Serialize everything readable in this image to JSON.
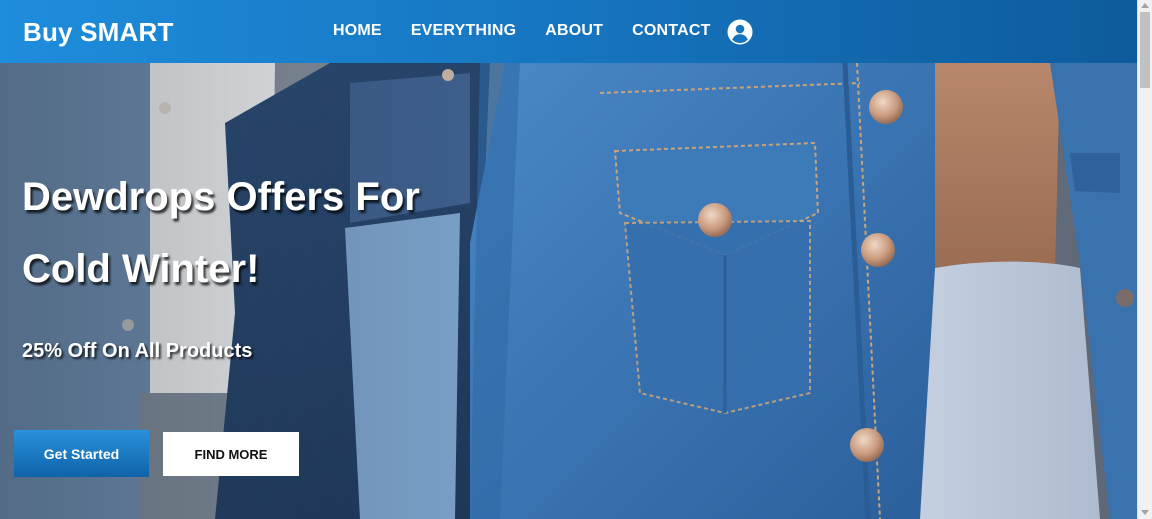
{
  "brand": {
    "name": "Buy SMART"
  },
  "nav": {
    "items": [
      {
        "label": "HOME"
      },
      {
        "label": "EVERYTHING"
      },
      {
        "label": "ABOUT"
      },
      {
        "label": "CONTACT"
      }
    ],
    "account_icon": "user-circle-icon"
  },
  "hero": {
    "headline_line1": "Dewdrops Offers For",
    "headline_line2": "Cold Winter!",
    "subheadline": "25% Off On All Products",
    "primary_button": "Get Started",
    "secondary_button": "FIND MORE",
    "background_image": "denim-jacket-photo"
  },
  "colors": {
    "nav_gradient_start": "#1e8ddc",
    "nav_gradient_end": "#0d5b9c",
    "denim": "#3b78b8",
    "button_primary": "#1b7ac8",
    "text": "#ffffff"
  }
}
